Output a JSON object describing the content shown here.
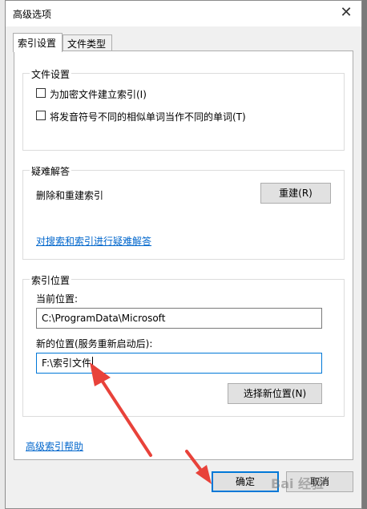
{
  "window": {
    "title": "高级选项",
    "close_glyph": "✕"
  },
  "tabs": [
    {
      "label": "索引设置",
      "active": true
    },
    {
      "label": "文件类型",
      "active": false
    }
  ],
  "file_settings": {
    "title": "文件设置",
    "options": [
      {
        "label": "为加密文件建立索引(I)",
        "checked": false
      },
      {
        "label": "将发音符号不同的相似单词当作不同的单词(T)",
        "checked": false
      }
    ]
  },
  "troubleshoot": {
    "title": "疑难解答",
    "rebuild_label": "删除和重建索引",
    "rebuild_button": "重建(R)",
    "link": "对搜索和索引进行疑难解答"
  },
  "index_location": {
    "title": "索引位置",
    "current_label": "当前位置:",
    "current_value": "C:\\ProgramData\\Microsoft",
    "new_label": "新的位置(服务重新启动后):",
    "new_value": "F:\\索引文件",
    "select_button": "选择新位置(N)"
  },
  "footer": {
    "help_link": "高级索引帮助",
    "ok_button": "确定",
    "cancel_button": "取消"
  },
  "watermark": "Bai 经验",
  "colors": {
    "accent": "#0078d7",
    "link": "#0066cc",
    "arrow": "#e8423a"
  }
}
